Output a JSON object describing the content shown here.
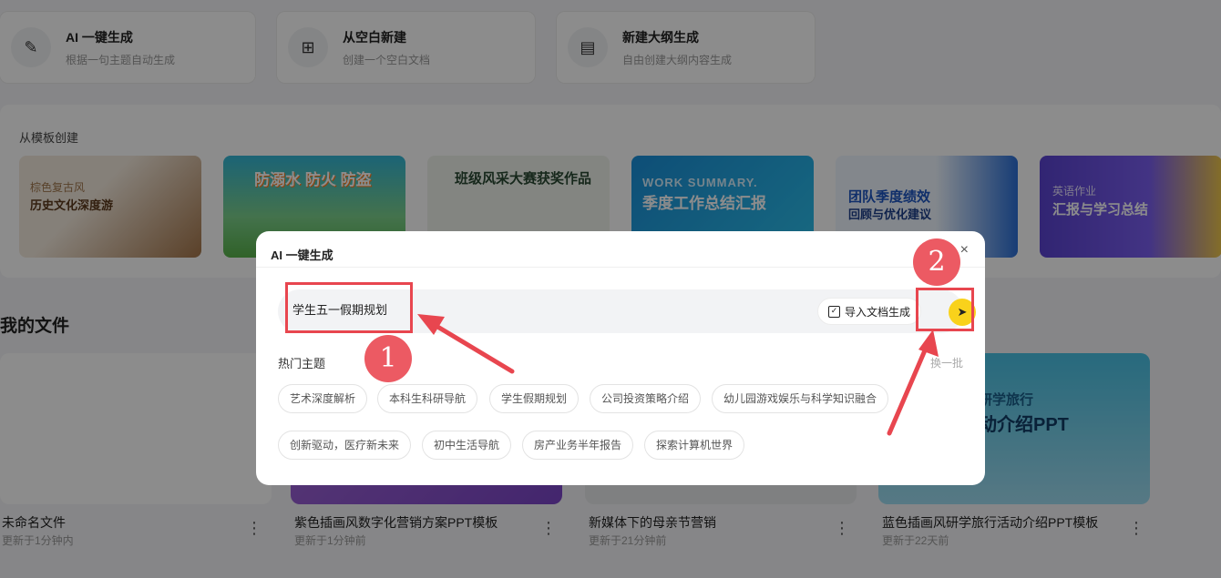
{
  "quick_actions": [
    {
      "title": "AI 一键生成",
      "subtitle": "根据一句主题自动生成",
      "icon": "magic-wand-icon"
    },
    {
      "title": "从空白新建",
      "subtitle": "创建一个空白文档",
      "icon": "plus-square-icon"
    },
    {
      "title": "新建大纲生成",
      "subtitle": "自由创建大纲内容生成",
      "icon": "document-icon"
    }
  ],
  "templates": {
    "heading": "从模板创建",
    "items": [
      {
        "small": "棕色复古风",
        "title": "历史文化深度游"
      },
      {
        "small": "",
        "title": "防溺水 防火 防盗"
      },
      {
        "small": "",
        "title": "班级风采大赛获奖作品"
      },
      {
        "small": "WORK SUMMARY.",
        "title": "季度工作总结汇报"
      },
      {
        "small": "回顾与优化建议",
        "title": "团队季度绩效"
      },
      {
        "small": "英语作业",
        "title": "汇报与学习总结"
      }
    ]
  },
  "files": {
    "heading": "我的文件",
    "items": [
      {
        "name": "未命名文件",
        "meta": "更新于1分钟内"
      },
      {
        "name": "紫色插画风数字化营销方案PPT模板",
        "meta": "更新于1分钟前"
      },
      {
        "name": "新媒体下的母亲节营销",
        "meta": "更新于21分钟前"
      },
      {
        "name": "蓝色插画风研学旅行活动介绍PPT模板",
        "meta": "更新于22天前"
      }
    ],
    "travel_thumb": {
      "line1": "研学旅行",
      "line2": "动介绍PPT"
    }
  },
  "modal": {
    "title": "AI 一键生成",
    "close": "×",
    "prompt_value": "学生五一假期规划",
    "import_label": "导入文档生成",
    "send_icon": "send-arrow-icon",
    "hot_label": "热门主题",
    "refresh_label": "换一批",
    "topics_row1": [
      "艺术深度解析",
      "本科生科研导航",
      "学生假期规划",
      "公司投资策略介绍",
      "幼儿园游戏娱乐与科学知识融合"
    ],
    "topics_row2": [
      "创新驱动，医疗新未来",
      "初中生活导航",
      "房产业务半年报告",
      "探索计算机世界"
    ]
  },
  "annotations": {
    "badge1": "1",
    "badge2": "2",
    "color": "#e8464f"
  }
}
